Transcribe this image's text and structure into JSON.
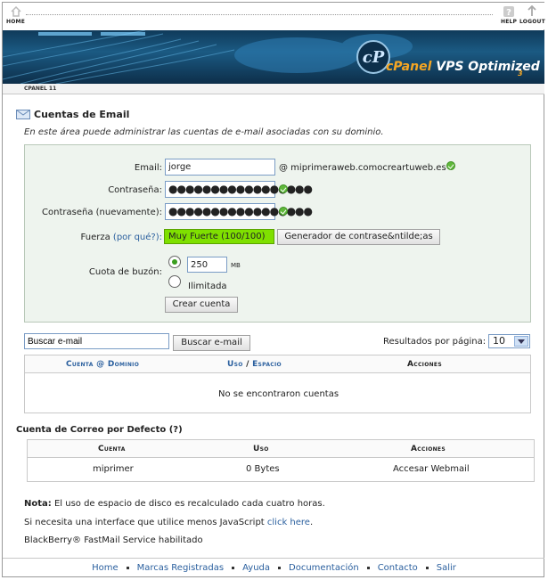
{
  "topnav": {
    "home_label": "HOME",
    "help_label": "HELP",
    "logout_label": "LOGOUT"
  },
  "banner": {
    "logo_prefix": "cPanel",
    "logo_text": "VPS Optimized",
    "logo_suffix": "3",
    "version": "CPANEL 11"
  },
  "page": {
    "title": "Cuentas de Email",
    "intro": "En este área puede administrar las cuentas de e-mail asociadas con su dominio."
  },
  "form": {
    "email_label": "Email:",
    "email_value": "jorge",
    "domain": "@ miprimeraweb.comocreartuweb.es",
    "password_label": "Contraseña:",
    "password_mask": "●●●●●●●●●●●●●●●●●",
    "password_confirm_label": "Contraseña (nuevamente):",
    "password_confirm_mask": "●●●●●●●●●●●●●●●●●",
    "strength_label": "Fuerza",
    "strength_why": "(por qué?):",
    "strength_value": "Muy Fuerte (100/100)",
    "strength_percent": 100,
    "generator_button": "Generador de contrase&ntilde;as",
    "quota_label": "Cuota de buzón:",
    "quota_value": "250",
    "quota_unit": "MB",
    "unlimited_label": "Ilimitada",
    "quota_selected": "limited",
    "create_button": "Crear cuenta"
  },
  "search": {
    "value": "Buscar e-mail",
    "button": "Buscar e-mail",
    "per_page_label": "Resultados por página:",
    "per_page_value": "10"
  },
  "accounts_table": {
    "col_account": "Cuenta",
    "col_at": "@",
    "col_domain": "Dominio",
    "col_usage": "Uso",
    "col_slash": "/",
    "col_space": "Espacio",
    "col_actions": "Acciones",
    "empty_message": "No se encontraron cuentas"
  },
  "default_section": {
    "title": "Cuenta de Correo por Defecto",
    "help": "(?)",
    "headers": [
      "Cuenta",
      "Uso",
      "Acciones"
    ],
    "row": {
      "account": "miprimer",
      "usage": "0 Bytes",
      "action": "Accesar Webmail"
    }
  },
  "notes": {
    "note_bold": "Nota:",
    "note_text": " El uso de espacio de disco es recalculado cada cuatro horas.",
    "js_text": "Si necesita una interface que utilice menos JavaScript ",
    "js_link": "click here",
    "js_end": ".",
    "blackberry": "BlackBerry® FastMail Service habilitado"
  },
  "footer": {
    "links": [
      "Home",
      "Marcas Registradas",
      "Ayuda",
      "Documentación",
      "Contacto",
      "Salir"
    ]
  },
  "colors": {
    "link": "#2a5f9e",
    "strength_bar": "#7fe000",
    "ok_icon": "#5fb83a",
    "form_bg": "#eef4ee",
    "banner": "#1b5a83"
  }
}
